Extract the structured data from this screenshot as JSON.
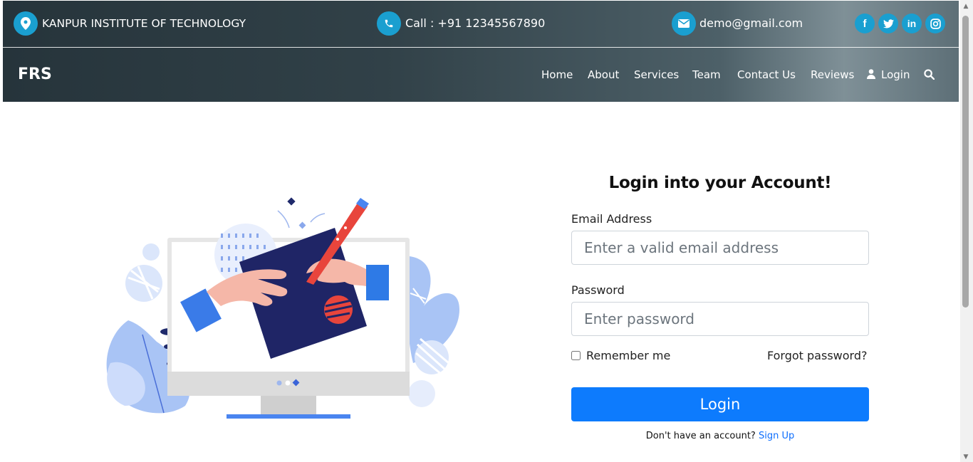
{
  "topbar": {
    "institute": "KANPUR INSTITUTE OF TECHNOLOGY",
    "phone": "Call : +91 12345567890",
    "email": "demo@gmail.com",
    "social": [
      {
        "icon": "facebook-icon",
        "glyph": "f"
      },
      {
        "icon": "twitter-icon",
        "glyph": "t"
      },
      {
        "icon": "linkedin-icon",
        "glyph": "in"
      },
      {
        "icon": "instagram-icon",
        "glyph": "◎"
      }
    ]
  },
  "navbar": {
    "brand": "FRS",
    "items": [
      "Home",
      "About",
      "Services",
      "Team",
      "Contact Us",
      "Reviews"
    ],
    "login_label": "Login"
  },
  "form": {
    "title": "Login into your Account!",
    "email_label": "Email Address",
    "email_placeholder": "Enter a valid email address",
    "password_label": "Password",
    "password_placeholder": "Enter password",
    "remember_label": "Remember me",
    "forgot_label": "Forgot password?",
    "login_button": "Login",
    "signup_prompt": "Don't have an account?",
    "signup_link": "Sign Up"
  },
  "colors": {
    "accent": "#1a9fd0",
    "button": "#0d7bfd",
    "link": "#0d6efd"
  }
}
